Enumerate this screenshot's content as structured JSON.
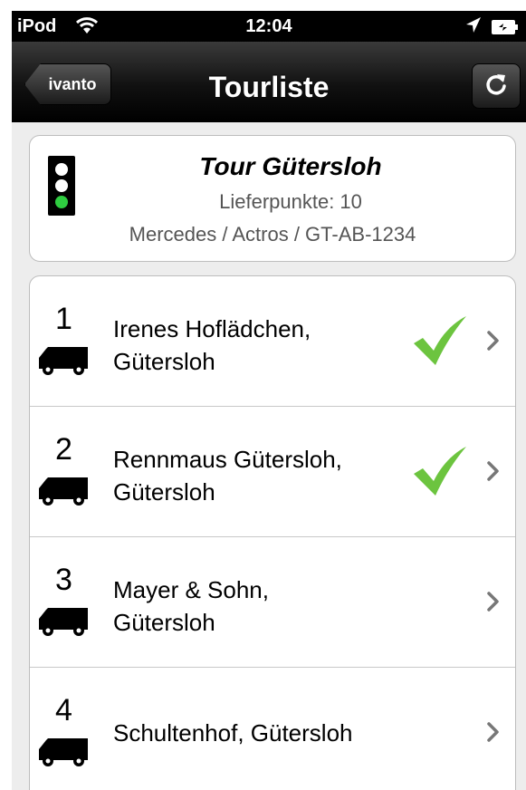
{
  "status_bar": {
    "carrier": "iPod",
    "time": "12:04"
  },
  "nav": {
    "back_label": "ivanto",
    "title": "Tourliste"
  },
  "tour": {
    "title": "Tour Gütersloh",
    "stops_label": "Lieferpunkte: 10",
    "vehicle": "Mercedes / Actros / GT-AB-1234",
    "traffic_light": "green"
  },
  "stops": [
    {
      "number": "1",
      "name_line1": "Irenes Hoflädchen,",
      "name_line2": "Gütersloh",
      "done": true
    },
    {
      "number": "2",
      "name_line1": "Rennmaus Gütersloh,",
      "name_line2": "Gütersloh",
      "done": true
    },
    {
      "number": "3",
      "name_line1": "Mayer & Sohn,",
      "name_line2": "Gütersloh",
      "done": false
    },
    {
      "number": "4",
      "name_line1": "Schultenhof, Gütersloh",
      "name_line2": "",
      "done": false
    }
  ],
  "colors": {
    "check_green": "#6cc43f",
    "light_green": "#2ecc40"
  }
}
